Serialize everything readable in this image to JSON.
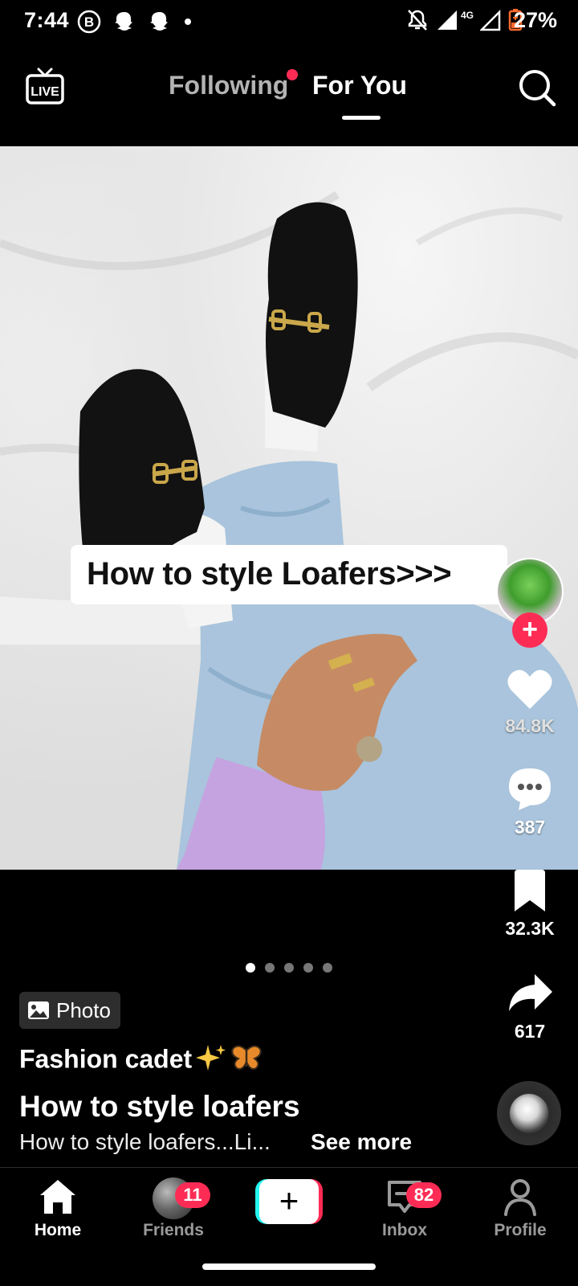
{
  "status_bar": {
    "time": "7:44",
    "left_icons": [
      "b-circle-icon",
      "snapchat-icon",
      "snapchat-icon",
      "dot-icon"
    ],
    "right_icons": [
      "mute-bell-icon",
      "signal-icon",
      "4g-signal-icon",
      "battery-icon"
    ],
    "network": "4G",
    "battery": "27%"
  },
  "top_nav": {
    "live_label": "LIVE",
    "tabs": [
      {
        "label": "Following",
        "active": false,
        "has_dot": true
      },
      {
        "label": "For You",
        "active": true
      }
    ]
  },
  "photo": {
    "caption": "How to style Loafers>>>",
    "page_count": 5,
    "current_page": 1
  },
  "actions": {
    "likes": "84.8K",
    "comments": "387",
    "saves": "32.3K",
    "shares": "617"
  },
  "post": {
    "badge_label": "Photo",
    "author": "Fashion cadet",
    "author_emojis": [
      "sparkles",
      "butterfly"
    ],
    "title": "How to style loafers",
    "description": "How to style loafers...Li...",
    "see_more": "See more"
  },
  "bottom_nav": {
    "items": [
      {
        "label": "Home",
        "active": true
      },
      {
        "label": "Friends",
        "active": false,
        "badge": "11"
      },
      {
        "label": "",
        "active": false
      },
      {
        "label": "Inbox",
        "active": false,
        "badge": "82"
      },
      {
        "label": "Profile",
        "active": false
      }
    ]
  },
  "colors": {
    "accent": "#fe2c55",
    "cyan": "#25f4ee",
    "background": "#000000",
    "inactive_tab": "#b3b3b3"
  }
}
